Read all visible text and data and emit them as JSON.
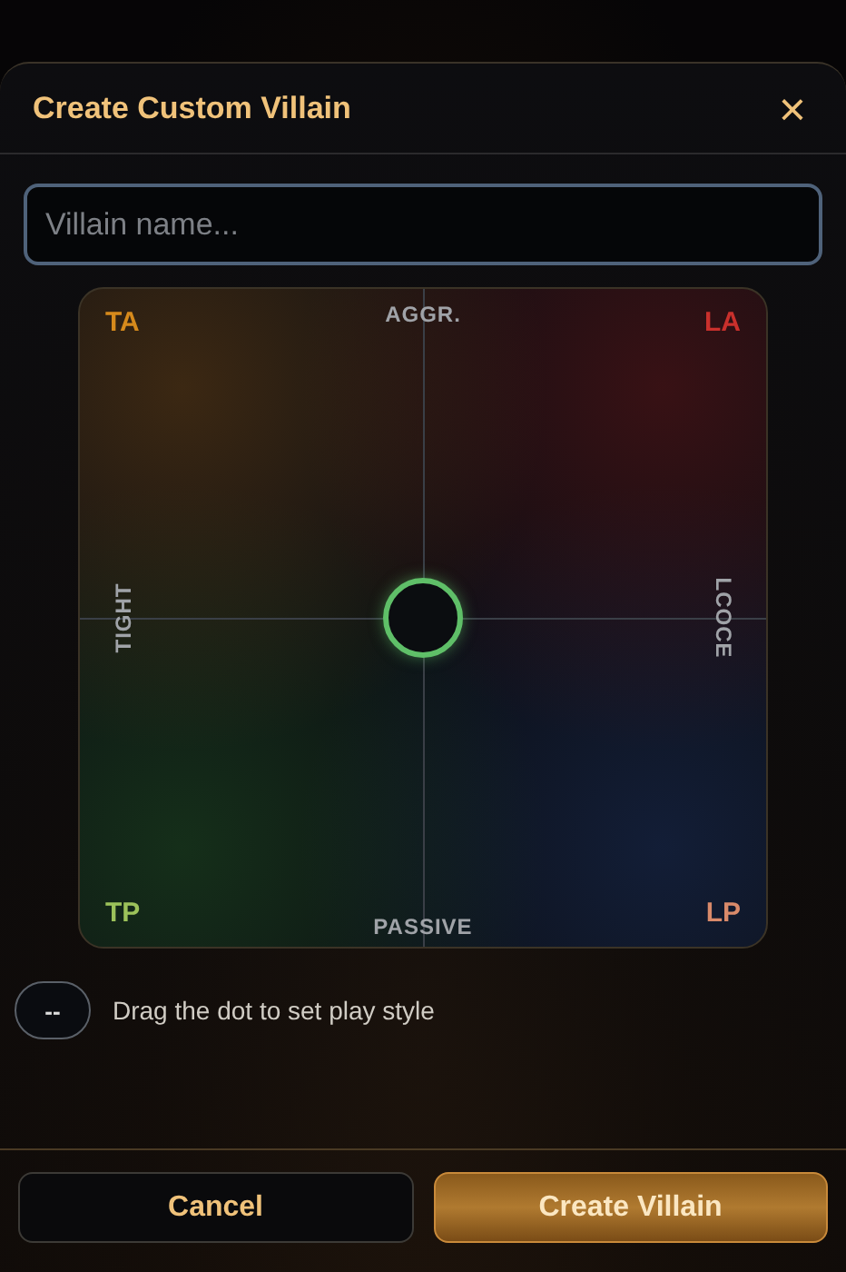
{
  "dialog": {
    "title": "Create Custom Villain",
    "close": "×"
  },
  "name_field": {
    "placeholder": "Villain name..."
  },
  "grid": {
    "corners": [
      {
        "label": "TA",
        "color": "#d68a1c"
      },
      {
        "label": "LA",
        "color": "#c9302c"
      },
      {
        "label": "TP",
        "color": "#9cc25a"
      },
      {
        "label": "LP",
        "color": "#d98a6a"
      }
    ],
    "top": "AGGR.",
    "bottom": "PASSIVE",
    "left": "TIGHT",
    "right": "LCOCE"
  },
  "hint": {
    "badge": "--",
    "text": "Drag the dot to set play style"
  },
  "buttons": [
    {
      "label": "Cancel",
      "kind": "secondary"
    },
    {
      "label": "Create Villain",
      "kind": "primary"
    }
  ]
}
